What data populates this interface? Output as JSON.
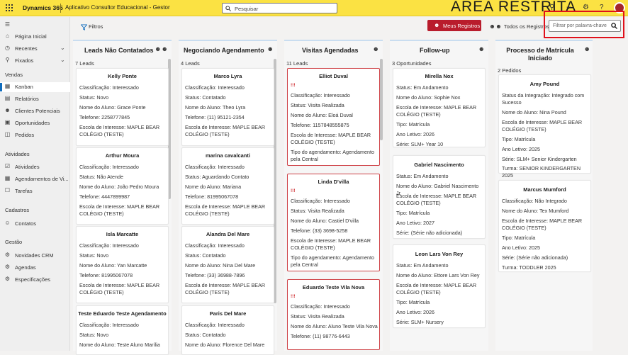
{
  "app": {
    "brand": "Dynamics 365",
    "name": "Aplicativo Consultor Educacional - Gestor",
    "search_placeholder": "Pesquisar",
    "restricted": "ÁREA RESTRITA"
  },
  "sidebar": {
    "items_top": [
      {
        "label": "Página Inicial",
        "icon": "home-icon"
      },
      {
        "label": "Recentes",
        "icon": "clock-icon"
      },
      {
        "label": "Fixados",
        "icon": "pin-icon"
      }
    ],
    "vendas_header": "Vendas",
    "vendas": [
      {
        "label": "Kanban",
        "icon": "kanban-icon"
      },
      {
        "label": "Relatórios",
        "icon": "report-icon"
      },
      {
        "label": "Clientes Potenciais",
        "icon": "users-icon"
      },
      {
        "label": "Oportunidades",
        "icon": "opportunity-icon"
      },
      {
        "label": "Pedidos",
        "icon": "order-icon"
      }
    ],
    "atividades_header": "Atividades",
    "atividades": [
      {
        "label": "Atividades",
        "icon": "activity-icon"
      },
      {
        "label": "Agendamentos de Vi...",
        "icon": "calendar-icon"
      },
      {
        "label": "Tarefas",
        "icon": "task-icon"
      }
    ],
    "cadastros_header": "Cadastros",
    "cadastros": [
      {
        "label": "Contatos",
        "icon": "contact-icon"
      }
    ],
    "gestao_header": "Gestão",
    "gestao": [
      {
        "label": "Novidades CRM",
        "icon": "news-icon"
      },
      {
        "label": "Agendas",
        "icon": "agenda-icon"
      },
      {
        "label": "Especificações",
        "icon": "spec-icon"
      }
    ]
  },
  "toolbar": {
    "filtros": "Filtros",
    "meus_registros": "Meus Registros",
    "todos_registros": "Todos os Registros",
    "keyword_placeholder": "Filtrar por palavra-chave"
  },
  "columns": [
    {
      "title": "Leads Não Contatados",
      "count": "7 Leads",
      "cards": [
        {
          "name": "Kelly Ponte",
          "lines": [
            "Classificação: Interessado",
            "Status: Novo",
            "Nome do Aluno: Grace Ponte",
            "Telefone: 2258777845",
            "Escola de Interesse: MAPLE BEAR COLÉGIO (TESTE)"
          ]
        },
        {
          "name": "Arthur Moura",
          "lines": [
            "Classificação: Interessado",
            "Status: Não Atende",
            "Nome do Aluno: João Pedro Moura",
            "Telefone: 4447899987",
            "Escola de Interesse: MAPLE BEAR COLÉGIO (TESTE)"
          ]
        },
        {
          "name": "Isla Marcatte",
          "lines": [
            "Classificação: Interessado",
            "Status: Novo",
            "Nome do Aluno: Yan Marcatte",
            "Telefone: 81995067078",
            "Escola de Interesse: MAPLE BEAR COLÉGIO (TESTE)"
          ]
        },
        {
          "name": "Teste Eduardo Teste Agendamento",
          "lines": [
            "Classificação: Interessado",
            "Status: Novo",
            "Nome do Aluno: Teste Aluno Marília"
          ]
        }
      ]
    },
    {
      "title": "Negociando Agendamento",
      "count": "4 Leads",
      "cards": [
        {
          "name": "Marco Lyra",
          "lines": [
            "Classificação: Interessado",
            "Status: Contatado",
            "Nome do Aluno: Theo Lyra",
            "Telefone: (11) 95121-2354",
            "Escola de Interesse: MAPLE BEAR COLÉGIO (TESTE)"
          ]
        },
        {
          "name": "marina cavalcanti",
          "lines": [
            "Classificação: Interessado",
            "Status: Aguardando Contato",
            "Nome do Aluno: Mariana",
            "Telefone: 81995067078",
            "Escola de Interesse: MAPLE BEAR COLÉGIO (TESTE)"
          ]
        },
        {
          "name": "Alandra Del Mare",
          "lines": [
            "Classificação: Interessado",
            "Status: Contatado",
            "Nome do Aluno: Nina Del Mare",
            "Telefone: (33) 36988-7896",
            "Escola de Interesse: MAPLE BEAR COLÉGIO (TESTE)"
          ]
        },
        {
          "name": "Paris Del Mare",
          "lines": [
            "Classificação: Interessado",
            "Status: Contatado",
            "Nome do Aluno: Florence Del Mare"
          ]
        }
      ]
    },
    {
      "title": "Visitas Agendadas",
      "count": "11 Leads",
      "cards": [
        {
          "name": "Elliot Duval",
          "warn": "!!!",
          "lines": [
            "Classificação: Interessado",
            "Status: Visita Realizada",
            "Nome do Aluno: Eloá Duval",
            "Telefone: 1157848555875",
            "Escola de Interesse: MAPLE BEAR COLÉGIO (TESTE)",
            "Tipo do agendamento: Agendamento pela Central"
          ]
        },
        {
          "name": "Linda D'villa",
          "warn": "!!!",
          "lines": [
            "Classificação: Interessado",
            "Status: Visita Realizada",
            "Nome do Aluno: Castiel D'villa",
            "Telefone: (33) 3698-5258",
            "Escola de Interesse: MAPLE BEAR COLÉGIO (TESTE)",
            "Tipo do agendamento: Agendamento pela Central"
          ]
        },
        {
          "name": "Eduardo Teste Vila Nova",
          "warn": "!!!",
          "lines": [
            "Classificação: Interessado",
            "Status: Visita Realizada",
            "Nome do Aluno: Aluno Teste Vila Nova",
            "Telefone: (11) 98776-6443"
          ]
        }
      ]
    },
    {
      "title": "Follow-up",
      "count": "3 Oportunidades",
      "cards": [
        {
          "name": "Mirella Nox",
          "lines": [
            "Status: Em Andamento",
            "Nome do Aluno: Sophie Nox",
            "Escola de Interesse: MAPLE BEAR COLÉGIO (TESTE)",
            "Tipo: Matrícula",
            "Ano Letivo: 2026",
            "Série: SLM+ Year 10"
          ]
        },
        {
          "name": "Gabriel Nascimento",
          "lines": [
            "Status: Em Andamento",
            "Nome do Aluno: Gabriel Nascimento Jr.",
            "Escola de Interesse: MAPLE BEAR COLÉGIO (TESTE)",
            "Tipo: Matrícula",
            "Ano Letivo: 2027",
            "Série: (Série não adicionada)"
          ]
        },
        {
          "name": "Leon Lars Von Rey",
          "lines": [
            "Status: Em Andamento",
            "Nome do Aluno: Ettore Lars Von Rey",
            "Escola de Interesse: MAPLE BEAR COLÉGIO (TESTE)",
            "Tipo: Matrícula",
            "Ano Letivo: 2026",
            "Série: SLM+ Nursery"
          ]
        }
      ]
    },
    {
      "title": "Processo de Matrícula Iniciado",
      "count": "2 Pedidos",
      "cards": [
        {
          "name": "Amy Pound",
          "lines": [
            "Status da Integração: Integrado com Sucesso",
            "Nome do Aluno: Nina Pound",
            "Escola de Interesse: MAPLE BEAR COLÉGIO (TESTE)",
            "Tipo: Matrícula",
            "Ano Letivo: 2025",
            "Série: SLM+ Senior Kindergarten",
            "Turma: SENIOR KINDERGARTEN 2025"
          ]
        },
        {
          "name": "Marcus Mumford",
          "lines": [
            "Classificação: Não Integrado",
            "Nome do Aluno: Tex Mumford",
            "Escola de Interesse: MAPLE BEAR COLÉGIO (TESTE)",
            "Tipo: Matrícula",
            "Ano Letivo: 2025",
            "Série: (Série não adicionada)",
            "Turma: TODDLER 2025"
          ]
        }
      ]
    }
  ]
}
